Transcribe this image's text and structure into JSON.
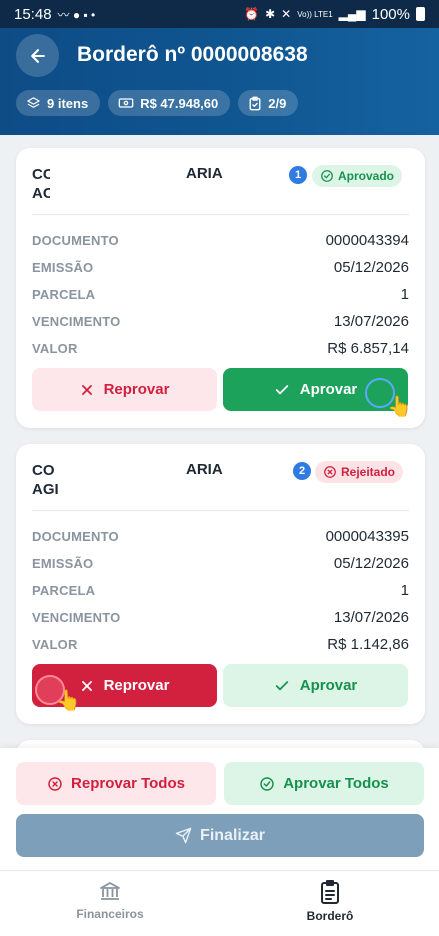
{
  "status_bar": {
    "time": "15:48",
    "battery": "100%",
    "network": "Vo)) LTE1"
  },
  "header": {
    "title": "Borderô nº 0000008638",
    "chips": [
      {
        "icon": "layers-icon",
        "label": "9 itens"
      },
      {
        "icon": "banknote-icon",
        "label": "R$ 47.948,60"
      },
      {
        "icon": "clipboard-check-icon",
        "label": "2/9"
      }
    ]
  },
  "labels": {
    "documento": "DOCUMENTO",
    "emissao": "EMISSÃO",
    "parcela": "PARCELA",
    "vencimento": "VENCIMENTO",
    "valor": "VALOR",
    "reprovar": "Reprovar",
    "aprovar": "Aprovar"
  },
  "items": [
    {
      "number": "1",
      "name_line1": "CC",
      "name_line2": "AC",
      "name_tail": "ARIA",
      "status": "Aprovado",
      "documento": "0000043394",
      "emissao": "05/12/2026",
      "parcela": "1",
      "vencimento": "13/07/2026",
      "valor": "R$ 6.857,14"
    },
    {
      "number": "2",
      "name_line1": "CO",
      "name_line2": "AGI",
      "name_tail": "ARIA",
      "status": "Rejeitado",
      "documento": "0000043395",
      "emissao": "05/12/2026",
      "parcela": "1",
      "vencimento": "13/07/2026",
      "valor": "R$ 1.142,86"
    }
  ],
  "actions": {
    "reprovar_todos": "Reprovar Todos",
    "aprovar_todos": "Aprovar Todos",
    "finalizar": "Finalizar"
  },
  "nav": [
    {
      "label": "Financeiros",
      "icon": "bank-icon",
      "active": false
    },
    {
      "label": "Borderô",
      "icon": "clipboard-list-icon",
      "active": true
    }
  ],
  "colors": {
    "header": "#0f5590",
    "approve": "#1da25b",
    "reject": "#d2203f",
    "finalize": "#7e9fba"
  }
}
